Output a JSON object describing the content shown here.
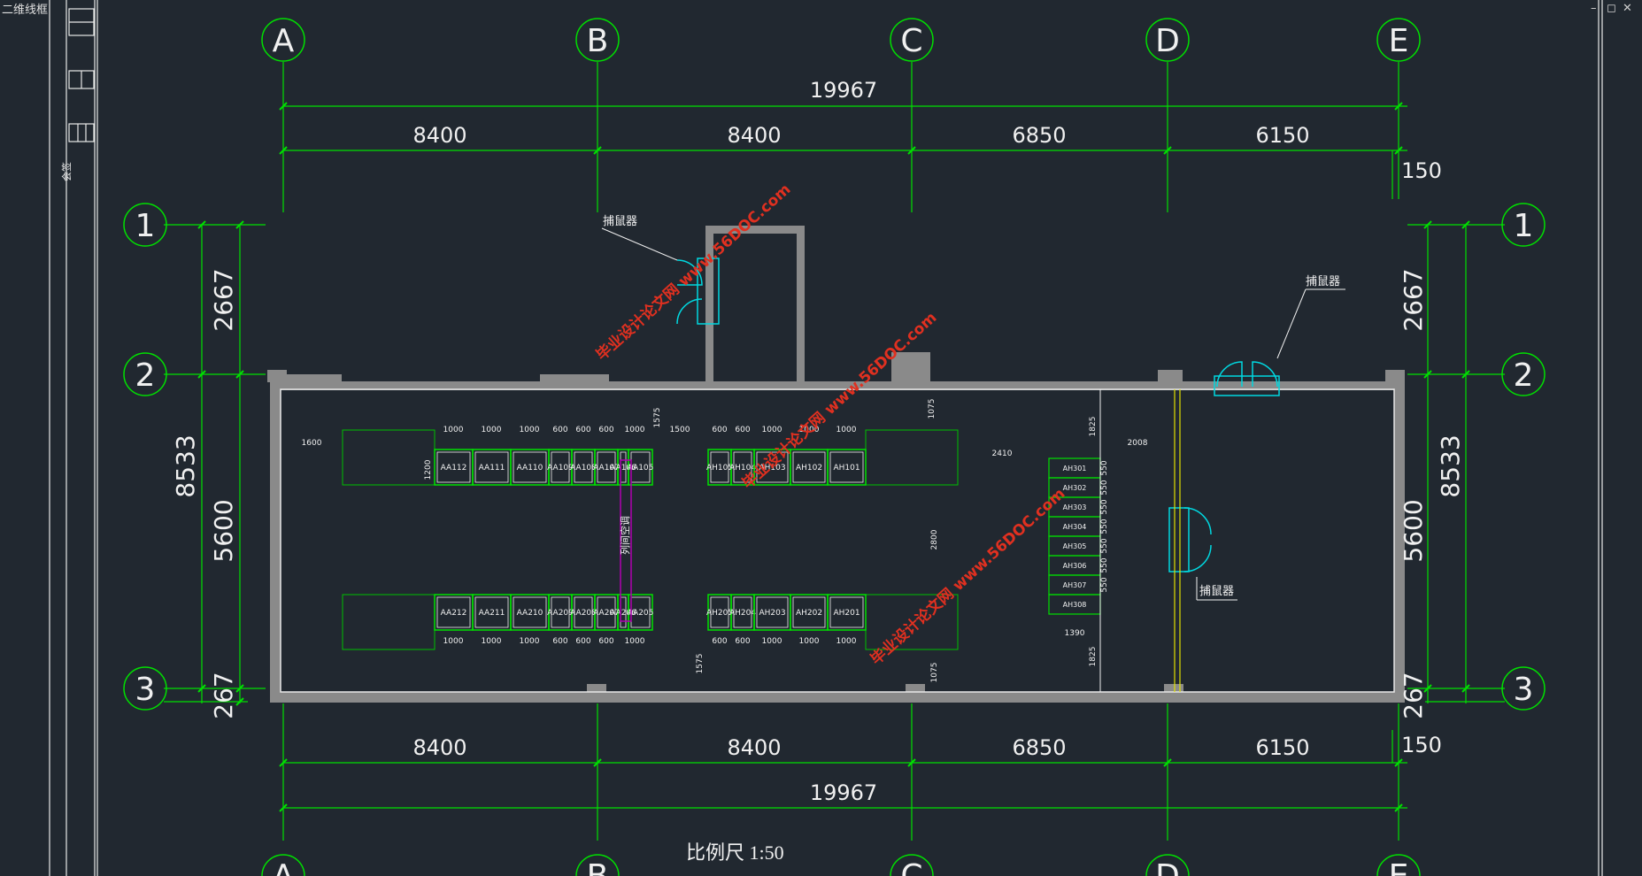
{
  "window": {
    "title": "二维线框",
    "minimize": "–",
    "restore": "◻",
    "close": "✕"
  },
  "title_strip": {
    "label": "会签"
  },
  "grid": {
    "columns": [
      "A",
      "B",
      "C",
      "D",
      "E"
    ],
    "rows": [
      "1",
      "2",
      "3"
    ]
  },
  "dimensions": {
    "total_width": "19967",
    "bays": [
      "8400",
      "8400",
      "6850",
      "6150"
    ],
    "offset": "150",
    "total_height": "8533",
    "row_bays": [
      "2667",
      "5600",
      "267"
    ]
  },
  "labels": {
    "fire_detector": "捕鼠器",
    "cabinet_label": "列间空调"
  },
  "row_aa1": [
    "AA112",
    "AA111",
    "AA110",
    "AA109",
    "AA108",
    "AA107",
    "AA106",
    "AA105"
  ],
  "row_aa2": [
    "AA212",
    "AA211",
    "AA210",
    "AA209",
    "AA208",
    "AA207",
    "AA206",
    "AA205"
  ],
  "row_ah1": [
    "AH105",
    "AH104",
    "AH103",
    "AH102",
    "AH101"
  ],
  "row_ah2": [
    "AH205",
    "AH204",
    "AH203",
    "AH202",
    "AH201"
  ],
  "row_ah3": [
    "AH301",
    "AH302",
    "AH303",
    "AH304",
    "AH305",
    "AH306",
    "AH307",
    "AH308"
  ],
  "inner_dims": {
    "top_left": [
      "1000",
      "1000",
      "1000",
      "600",
      "600",
      "600",
      "1000"
    ],
    "top_right": [
      "600",
      "600",
      "1000",
      "1000",
      "1000"
    ],
    "bottom_left": [
      "1000",
      "1000",
      "1000",
      "600",
      "600",
      "600",
      "1000"
    ],
    "bottom_right": [
      "600",
      "600",
      "1000",
      "1000",
      "1000"
    ],
    "left_gap": "1600",
    "row_depth": "1200",
    "aisle": "1500",
    "top_gap": "1575",
    "bottom_gap": "1575",
    "right_top": "1075",
    "right_bottom": "1075",
    "mid_vertical": "2800",
    "right_span": "2410",
    "door_span": "2008",
    "right_col": "1825",
    "right_col_bottom": "1825",
    "right_width": "1390",
    "right_cells": [
      "550",
      "550",
      "550",
      "550",
      "550",
      "550",
      "550"
    ]
  },
  "watermarks": [
    "毕业设计论文网 www.56DOC.com",
    "毕业设计论文网 www.56DOC.com",
    "毕业设计论文网 www.56DOC.com"
  ],
  "scale": "比例尺 1:50"
}
